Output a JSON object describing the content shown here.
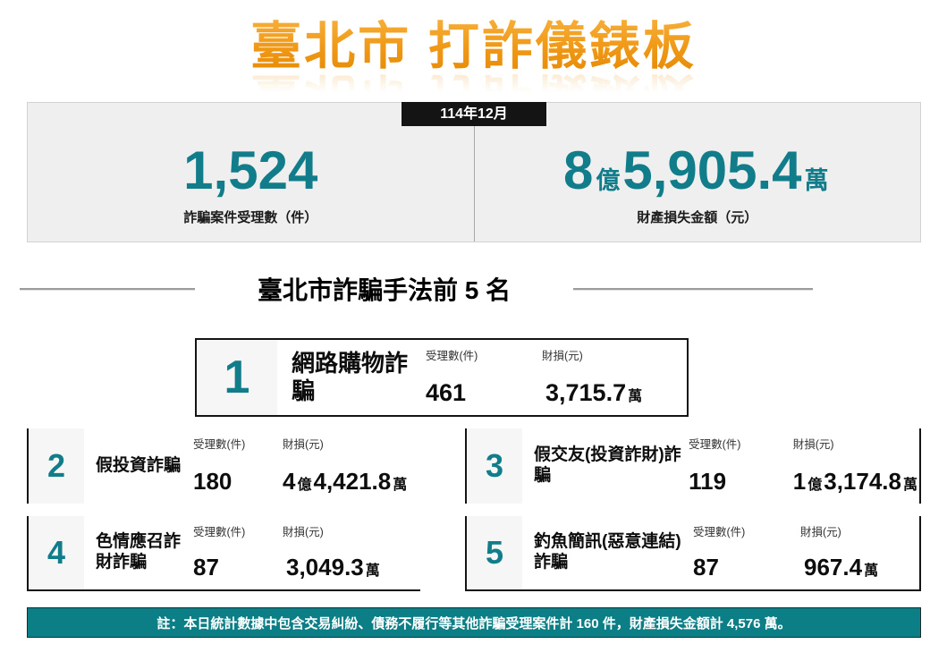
{
  "title": "臺北市 打詐儀錶板",
  "period_badge": "114年12月",
  "summary": {
    "cases": {
      "value": "1,524",
      "label": "詐騙案件受理數（件）"
    },
    "loss": {
      "big1": "8",
      "unit1": "億",
      "big2": "5,905.4",
      "unit2": "萬",
      "label": "財產損失金額（元）"
    }
  },
  "top5": {
    "section_title": "臺北市詐騙手法前 5 名",
    "col_cases": "受理數(件)",
    "col_loss": "財損(元)",
    "cards": [
      {
        "rank": "1",
        "name": "網路購物詐騙",
        "cases": "461",
        "loss_big1": "",
        "loss_unit1": "",
        "loss_big2": "3,715.7",
        "loss_unit2": "萬"
      },
      {
        "rank": "2",
        "name": "假投資詐騙",
        "cases": "180",
        "loss_big1": "4",
        "loss_unit1": "億",
        "loss_big2": "4,421.8",
        "loss_unit2": "萬"
      },
      {
        "rank": "3",
        "name": "假交友(投資詐財)詐騙",
        "cases": "119",
        "loss_big1": "1",
        "loss_unit1": "億",
        "loss_big2": "3,174.8",
        "loss_unit2": "萬"
      },
      {
        "rank": "4",
        "name": "色情應召詐財詐騙",
        "cases": "87",
        "loss_big1": "",
        "loss_unit1": "",
        "loss_big2": "3,049.3",
        "loss_unit2": "萬"
      },
      {
        "rank": "5",
        "name": "釣魚簡訊(惡意連結)詐騙",
        "cases": "87",
        "loss_big1": "",
        "loss_unit1": "",
        "loss_big2": "967.4",
        "loss_unit2": "萬"
      }
    ]
  },
  "footer_note": "註：本日統計數據中包含交易糾紛、債務不履行等其他詐騙受理案件計 160 件，財產損失金額計 4,576 萬。",
  "colors": {
    "accent_teal": "#117C8A",
    "footer_teal": "#0C7E86",
    "title_orange": "#F09A18"
  }
}
